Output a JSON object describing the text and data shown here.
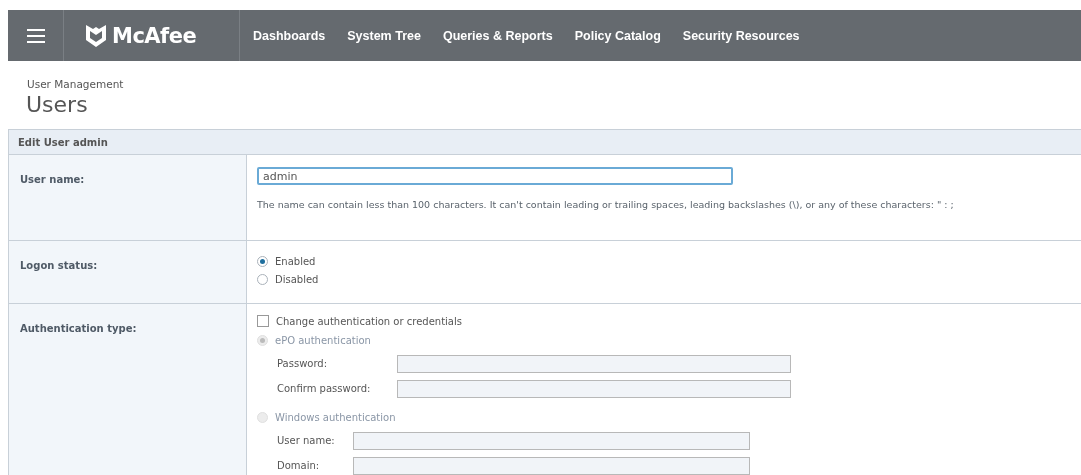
{
  "nav": {
    "logo": "McAfee",
    "items": [
      "Dashboards",
      "System Tree",
      "Queries & Reports",
      "Policy Catalog",
      "Security Resources"
    ]
  },
  "breadcrumb": "User Management",
  "page_title": "Users",
  "form": {
    "title": "Edit User admin",
    "rows": [
      {
        "kind": "text",
        "label": "User name:",
        "value": "admin",
        "hint": "The name can contain less than 100 characters. It can't contain leading or trailing spaces, leading backslashes (\\), or any of these characters: \" : ;"
      },
      {
        "kind": "radio",
        "label": "Logon status:",
        "options": [
          {
            "label": "Enabled",
            "selected": true
          },
          {
            "label": "Disabled",
            "selected": false
          }
        ]
      },
      {
        "kind": "auth",
        "label": "Authentication type:",
        "checkbox": {
          "label": "Change authentication or credentials",
          "checked": false
        },
        "options": [
          {
            "label": "ePO authentication",
            "selected": true,
            "disabled": true,
            "fields": [
              {
                "label": "Password:"
              },
              {
                "label": "Confirm password:"
              }
            ]
          },
          {
            "label": "Windows authentication",
            "selected": false,
            "disabled": true,
            "fields": [
              {
                "label": "User name:"
              },
              {
                "label": "Domain:"
              }
            ]
          }
        ]
      }
    ]
  }
}
